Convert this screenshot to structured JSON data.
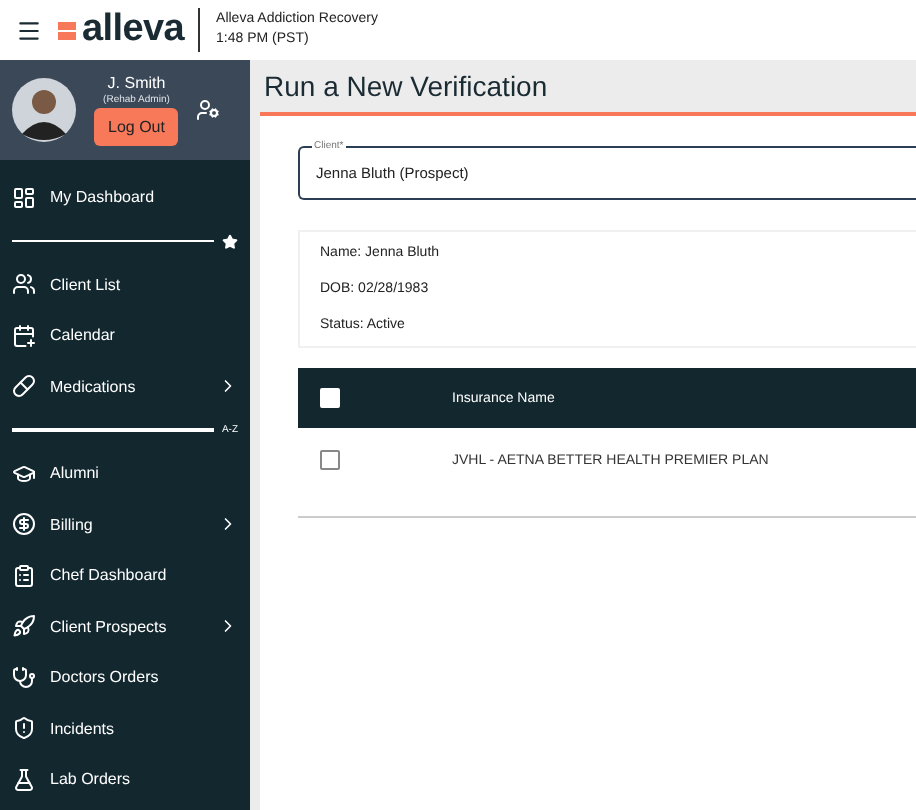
{
  "header": {
    "logo": "alleva",
    "facility": "Alleva Addiction Recovery",
    "time": "1:48 PM (PST)"
  },
  "user": {
    "name": "J. Smith",
    "role": "(Rehab Admin)",
    "logout": "Log Out"
  },
  "sidebar": {
    "items": [
      {
        "kind": "item",
        "label": "My Dashboard",
        "expandable": false
      },
      {
        "kind": "favorites"
      },
      {
        "kind": "item",
        "label": "Client List",
        "expandable": false
      },
      {
        "kind": "item",
        "label": "Calendar",
        "expandable": false
      },
      {
        "kind": "item",
        "label": "Medications",
        "expandable": true
      },
      {
        "kind": "divider",
        "label": "A-Z"
      },
      {
        "kind": "item",
        "label": "Alumni",
        "expandable": false
      },
      {
        "kind": "item",
        "label": "Billing",
        "expandable": true
      },
      {
        "kind": "item",
        "label": "Chef Dashboard",
        "expandable": false
      },
      {
        "kind": "item",
        "label": "Client Prospects",
        "expandable": true
      },
      {
        "kind": "item",
        "label": "Doctors Orders",
        "expandable": false
      },
      {
        "kind": "item",
        "label": "Incidents",
        "expandable": false
      },
      {
        "kind": "item",
        "label": "Lab Orders",
        "expandable": false
      }
    ]
  },
  "page": {
    "title": "Run a New Verification",
    "client_field": {
      "label": "Client*",
      "value": "Jenna Bluth (Prospect)"
    },
    "details": [
      "Name: Jenna Bluth",
      "DOB: 02/28/1983",
      "Status: Active"
    ],
    "table": {
      "columns": [
        "Insurance Name"
      ],
      "header_checked": false,
      "rows": [
        {
          "name": "JVHL - AETNA BETTER HEALTH PREMIER PLAN",
          "checked": false
        }
      ]
    }
  }
}
